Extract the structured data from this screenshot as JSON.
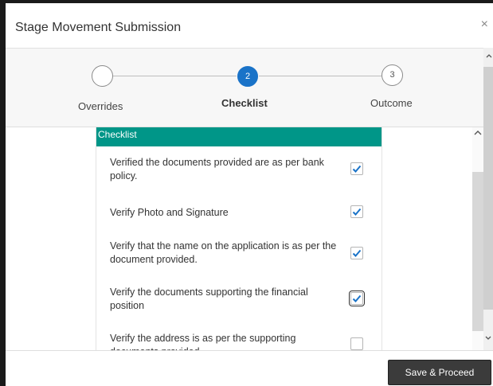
{
  "dialog": {
    "title": "Stage Movement Submission",
    "close": "×"
  },
  "stepper": {
    "steps": [
      {
        "number": "",
        "label": "Overrides"
      },
      {
        "number": "2",
        "label": "Checklist"
      },
      {
        "number": "3",
        "label": "Outcome"
      }
    ],
    "active_step": 2
  },
  "checklist": {
    "header": "Checklist",
    "items": [
      {
        "text": "Verified the documents provided are as per bank policy.",
        "checked": true
      },
      {
        "text": "Verify Photo and Signature",
        "checked": true
      },
      {
        "text": "Verify that the name on the application is as per the document provided.",
        "checked": true
      },
      {
        "text": "Verify the documents supporting the financial position",
        "checked": true
      },
      {
        "text": "Verify the address is as per the supporting documents provided.",
        "checked": false
      }
    ]
  },
  "footer": {
    "save_label": "Save & Proceed"
  },
  "icons": {
    "close": "close-icon",
    "check": "check-icon",
    "scroll_up": "chevron-up-icon",
    "scroll_down": "chevron-down-icon"
  },
  "colors": {
    "accent": "#009688",
    "active_step": "#1a73c8",
    "button": "#3b3b3b"
  }
}
